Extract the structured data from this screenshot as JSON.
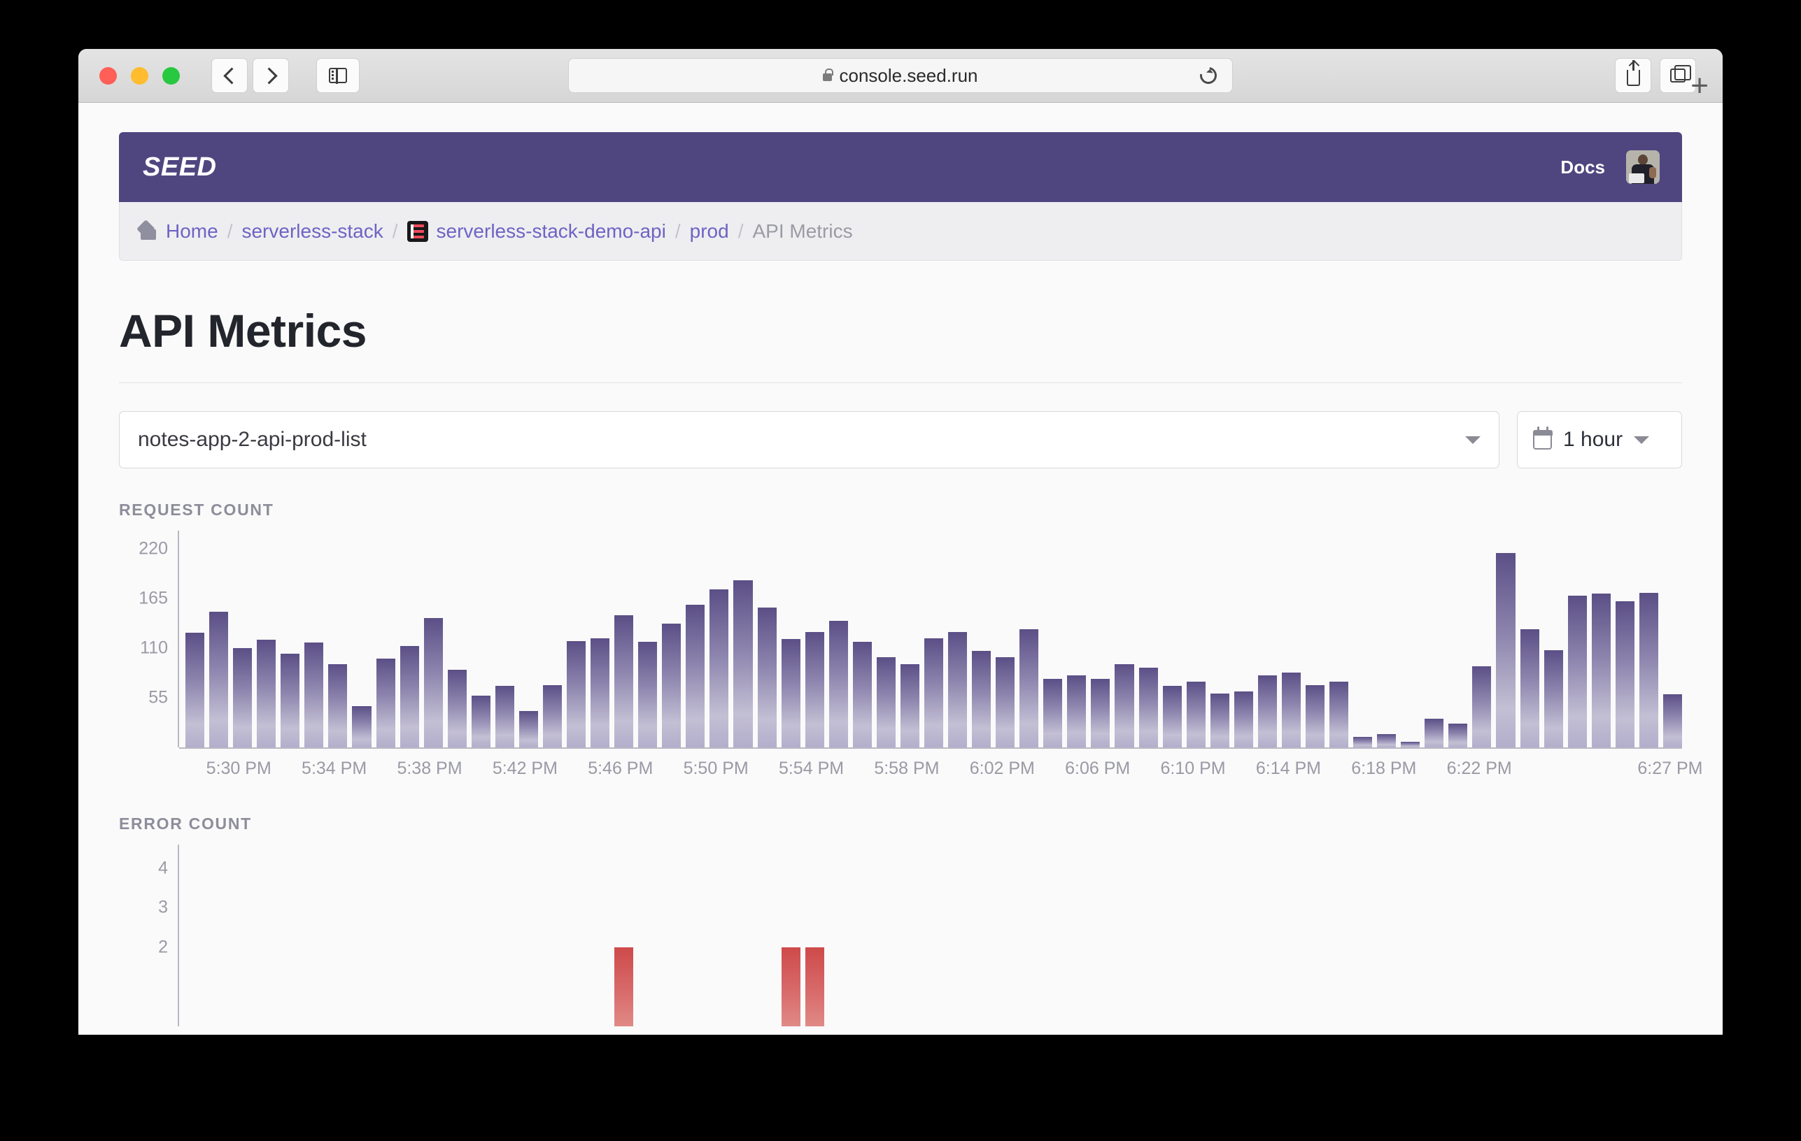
{
  "browser": {
    "url": "console.seed.run",
    "lock_icon": "lock-icon",
    "back_icon": "chevron-left-icon",
    "forward_icon": "chevron-right-icon",
    "sidebar_icon": "sidebar-toggle-icon",
    "reload_icon": "reload-icon",
    "share_icon": "share-icon",
    "tabs_icon": "new-tab-overview-icon",
    "new_tab_label": "+"
  },
  "header": {
    "brand": "SEED",
    "docs_label": "Docs",
    "avatar_icon": "user-avatar",
    "brand_color": "#4f4680"
  },
  "breadcrumb": {
    "items": [
      {
        "label": "Home",
        "icon": "home-icon",
        "current": false
      },
      {
        "label": "serverless-stack",
        "icon": "",
        "current": false
      },
      {
        "label": "serverless-stack-demo-api",
        "icon": "repo-icon",
        "current": false
      },
      {
        "label": "prod",
        "icon": "",
        "current": false
      },
      {
        "label": "API Metrics",
        "icon": "",
        "current": true
      }
    ],
    "separator": "/"
  },
  "main": {
    "title": "API Metrics",
    "endpoint_select": {
      "value": "notes-app-2-api-prod-list",
      "caret_icon": "chevron-down-icon"
    },
    "range_select": {
      "value": "1 hour",
      "calendar_icon": "calendar-icon",
      "caret_icon": "chevron-down-icon"
    }
  },
  "chart_data": [
    {
      "type": "bar",
      "title": "REQUEST COUNT",
      "xlabel": "",
      "ylabel": "",
      "ylim": [
        0,
        240
      ],
      "yticks": [
        55,
        110,
        165,
        220
      ],
      "grid": false,
      "legend": null,
      "bar_color": "#5b4f86",
      "x": [
        "5:28 PM",
        "5:29 PM",
        "5:30 PM",
        "5:31 PM",
        "5:32 PM",
        "5:33 PM",
        "5:34 PM",
        "5:35 PM",
        "5:36 PM",
        "5:37 PM",
        "5:38 PM",
        "5:39 PM",
        "5:40 PM",
        "5:41 PM",
        "5:42 PM",
        "5:43 PM",
        "5:44 PM",
        "5:45 PM",
        "5:46 PM",
        "5:47 PM",
        "5:48 PM",
        "5:49 PM",
        "5:50 PM",
        "5:51 PM",
        "5:52 PM",
        "5:53 PM",
        "5:54 PM",
        "5:55 PM",
        "5:56 PM",
        "5:57 PM",
        "5:58 PM",
        "5:59 PM",
        "6:00 PM",
        "6:01 PM",
        "6:02 PM",
        "6:03 PM",
        "6:04 PM",
        "6:05 PM",
        "6:06 PM",
        "6:07 PM",
        "6:08 PM",
        "6:09 PM",
        "6:10 PM",
        "6:11 PM",
        "6:12 PM",
        "6:13 PM",
        "6:14 PM",
        "6:15 PM",
        "6:16 PM",
        "6:17 PM",
        "6:18 PM",
        "6:19 PM",
        "6:20 PM",
        "6:21 PM",
        "6:22 PM",
        "6:23 PM",
        "6:24 PM",
        "6:25 PM",
        "6:26 PM",
        "6:27 PM"
      ],
      "values": [
        127,
        150,
        110,
        119,
        104,
        116,
        92,
        46,
        98,
        112,
        143,
        86,
        57,
        68,
        40,
        69,
        118,
        121,
        146,
        117,
        137,
        158,
        175,
        185,
        155,
        120,
        128,
        140,
        117,
        100,
        92,
        121,
        128,
        107,
        100,
        131,
        76,
        80,
        76,
        92,
        88,
        68,
        73,
        60,
        62,
        80,
        83,
        69,
        73,
        12,
        15,
        6,
        32,
        26,
        90,
        215,
        131,
        108,
        168,
        170,
        162,
        171,
        59
      ],
      "xtick_labels": [
        "5:30 PM",
        "5:34 PM",
        "5:38 PM",
        "5:42 PM",
        "5:46 PM",
        "5:50 PM",
        "5:54 PM",
        "5:58 PM",
        "6:02 PM",
        "6:06 PM",
        "6:10 PM",
        "6:14 PM",
        "6:18 PM",
        "6:22 PM",
        "6:27 PM"
      ]
    },
    {
      "type": "bar",
      "title": "ERROR COUNT",
      "xlabel": "",
      "ylabel": "",
      "ylim": [
        0,
        4.6
      ],
      "yticks": [
        2,
        3,
        4
      ],
      "grid": false,
      "legend": null,
      "bar_color": "#ce4a4a",
      "values": [
        0,
        0,
        0,
        0,
        0,
        0,
        0,
        0,
        0,
        0,
        0,
        0,
        0,
        0,
        0,
        0,
        0,
        0,
        2,
        0,
        0,
        0,
        0,
        0,
        0,
        2,
        2,
        0,
        0,
        0,
        0,
        0,
        0,
        0,
        0,
        0,
        0,
        0,
        0,
        0,
        0,
        0,
        0,
        0,
        0,
        0,
        0,
        0,
        0,
        0,
        0,
        0,
        0,
        0,
        0,
        0,
        0,
        0,
        0,
        0,
        0,
        0,
        0
      ]
    }
  ]
}
